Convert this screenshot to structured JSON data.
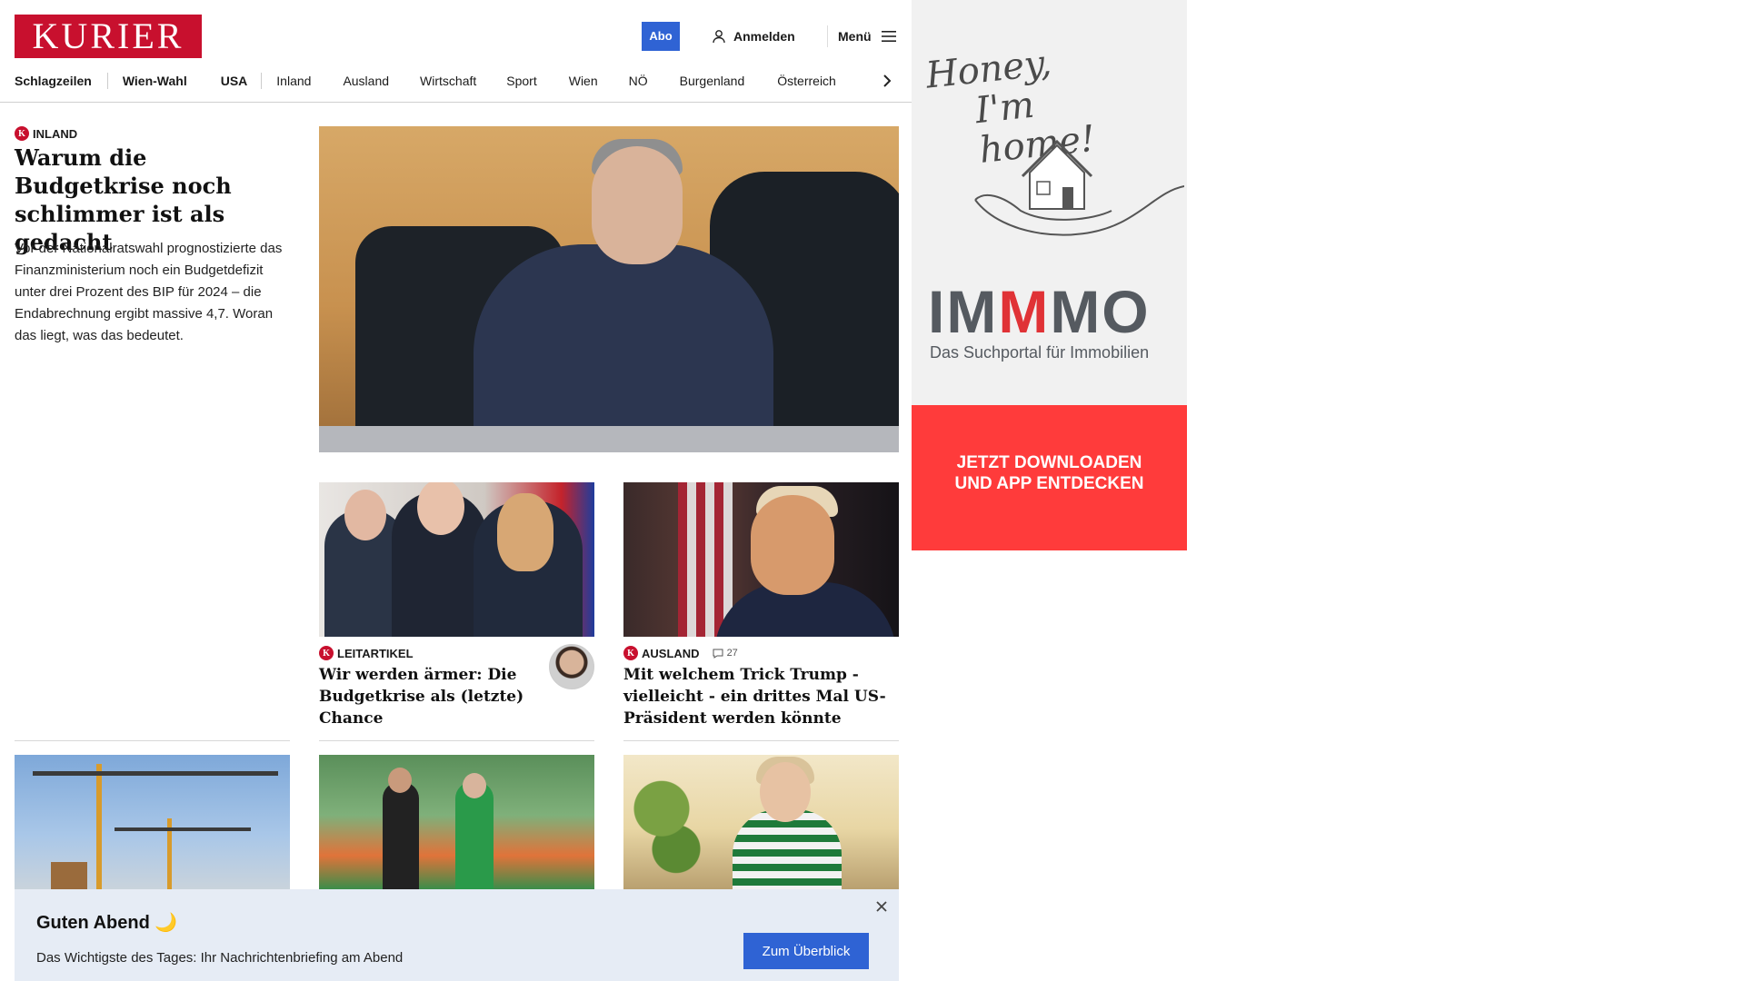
{
  "header": {
    "logo_text": "KURIER",
    "abo_label": "Abo",
    "login_label": "Anmelden",
    "menu_label": "Menü"
  },
  "nav": {
    "items": [
      "Schlagzeilen",
      "Wien-Wahl",
      "USA",
      "Inland",
      "Ausland",
      "Wirtschaft",
      "Sport",
      "Wien",
      "NÖ",
      "Burgenland",
      "Österreich"
    ]
  },
  "lead": {
    "kicker": "INLAND",
    "title": "Warum die Budgetkrise noch schlimmer ist als gedacht",
    "teaser": "Vor der Nationalratswahl prognostizierte das Finanzministerium noch ein Budgetdefizit unter drei Prozent des BIP für 2024 – die Endabrechnung ergibt massive 4,7. Woran das liegt, was das bedeutet."
  },
  "stories": [
    {
      "kicker": "LEITARTIKEL",
      "title": "Wir werden ärmer: Die Budgetkrise als (letzte) Chance"
    },
    {
      "kicker": "AUSLAND",
      "comments": "27",
      "title": "Mit welchem Trick Trump - vielleicht - ein drittes Mal US-Präsident werden könnte"
    }
  ],
  "briefing": {
    "title": "Guten Abend 🌙",
    "text": "Das Wichtigste des Tages: Ihr Nachrichtenbriefing am Abend",
    "button": "Zum Überblick"
  },
  "ad": {
    "script_line1": "Honey,",
    "script_line2": "I'm home!",
    "brand_a": "IM",
    "brand_b": "M",
    "brand_c": "MO",
    "subline": "Das Suchportal für Immobilien",
    "cta": "JETZT DOWNLOADEN\nUND APP ENTDECKEN"
  },
  "colors": {
    "brand_red": "#c8102e",
    "accent_blue": "#2f63d4",
    "ad_red": "#ff3b3b"
  }
}
